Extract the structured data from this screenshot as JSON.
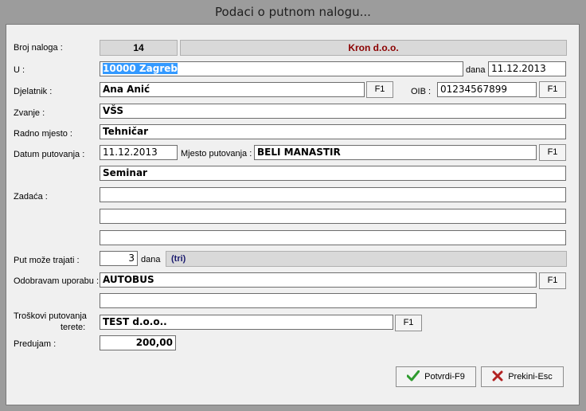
{
  "window": {
    "title": "Podaci o putnom nalogu..."
  },
  "form": {
    "broj_naloga": {
      "label": "Broj naloga :",
      "value": "14",
      "company": "Kron d.o.o."
    },
    "u": {
      "label": "U :",
      "value": "10000 Zagreb",
      "dana_label": "dana",
      "date": "11.12.2013"
    },
    "djelatnik": {
      "label": "Djelatnik :",
      "value": "Ana Anić",
      "f1": "F1",
      "oib_label": "OIB :",
      "oib": "01234567899",
      "oib_f1": "F1"
    },
    "zvanje": {
      "label": "Zvanje :",
      "value": "VŠS"
    },
    "radno_mjesto": {
      "label": "Radno mjesto :",
      "value": "Tehničar"
    },
    "datum_putovanja": {
      "label": "Datum putovanja :",
      "value": "11.12.2013",
      "mjesto_label": "Mjesto putovanja :",
      "mjesto": "BELI MANASTIR",
      "f1": "F1"
    },
    "zadaca": {
      "label": "Zadaća :",
      "lines": [
        "Seminar",
        "",
        "",
        ""
      ]
    },
    "trajanje": {
      "label": "Put može trajati :",
      "value": "3",
      "dana_label": "dana",
      "words": "(tri)"
    },
    "odobravam": {
      "label": "Odobravam uporabu :",
      "value": "AUTOBUS",
      "f1": "F1",
      "extra": ""
    },
    "troskovi": {
      "label_line1": "Troškovi putovanja",
      "label_line2": "terete:",
      "value": "TEST d.o.o..",
      "f1": "F1"
    },
    "predujam": {
      "label": "Predujam :",
      "value": "200,00"
    }
  },
  "buttons": {
    "confirm": "Potvrdi-F9",
    "cancel": "Prekini-Esc"
  },
  "colors": {
    "company": "#8b0000",
    "words": "#1a1a6e",
    "selection": "#3399ff",
    "check": "#2e9b2e",
    "cross": "#b22222"
  }
}
